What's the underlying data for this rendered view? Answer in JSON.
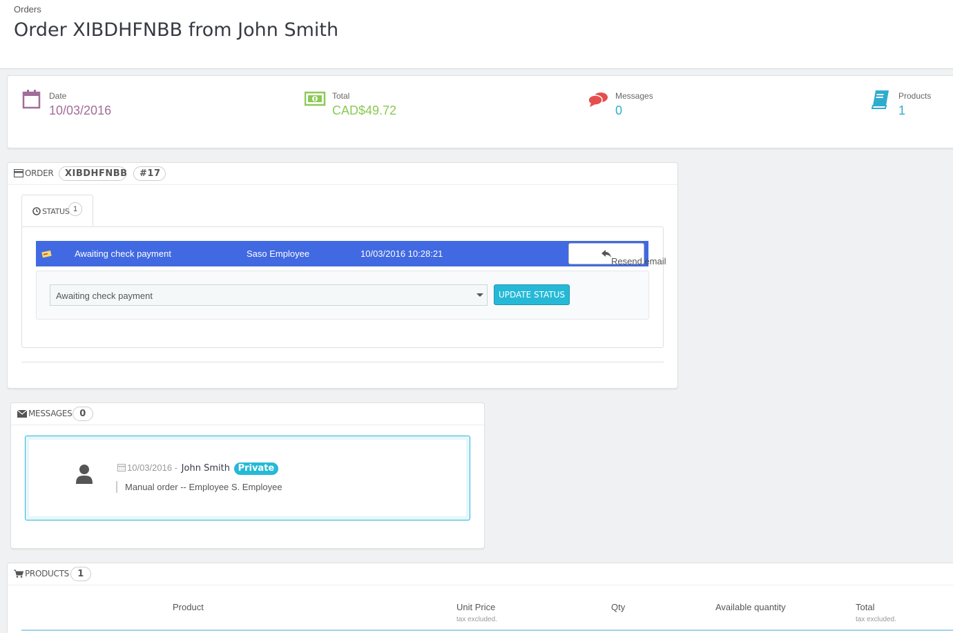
{
  "header": {
    "breadcrumb": "Orders",
    "title": "Order XIBDHFNBB from John Smith"
  },
  "kpis": {
    "date": {
      "label": "Date",
      "value": "10/03/2016",
      "icon": "calendar-icon",
      "color": "#a16d9a"
    },
    "total": {
      "label": "Total",
      "value": "CAD$49.72",
      "icon": "money-icon",
      "color": "#8bc954"
    },
    "messages": {
      "label": "Messages",
      "value": "0",
      "icon": "comments-icon",
      "color": "#e64e4e"
    },
    "products": {
      "label": "Products",
      "value": "1",
      "icon": "book-icon",
      "color": "#2eacce"
    }
  },
  "order_panel": {
    "title": "ORDER",
    "reference": "XIBDHFNBB",
    "id": "#17",
    "tab": {
      "label": "STATUS",
      "count": "1"
    },
    "history": [
      {
        "status": "Awaiting check payment",
        "employee": "Saso Employee",
        "datetime": "10/03/2016 10:28:21",
        "resend_label": "Resend email",
        "color": "#4169e1"
      }
    ],
    "status_select": {
      "value": "Awaiting check payment"
    },
    "update_label": "UPDATE STATUS"
  },
  "messages_panel": {
    "title": "MESSAGES",
    "count": "0",
    "message": {
      "date": "10/03/2016",
      "separator": "-",
      "author": "John Smith",
      "badge": "Private",
      "text": "Manual order -- Employee S. Employee"
    }
  },
  "products_panel": {
    "title": "PRODUCTS",
    "count": "1",
    "columns": [
      {
        "label": "Product",
        "sub": ""
      },
      {
        "label": "Unit Price",
        "sub": "tax excluded."
      },
      {
        "label": "Qty",
        "sub": ""
      },
      {
        "label": "Available quantity",
        "sub": ""
      },
      {
        "label": "Total",
        "sub": "tax excluded."
      }
    ]
  }
}
